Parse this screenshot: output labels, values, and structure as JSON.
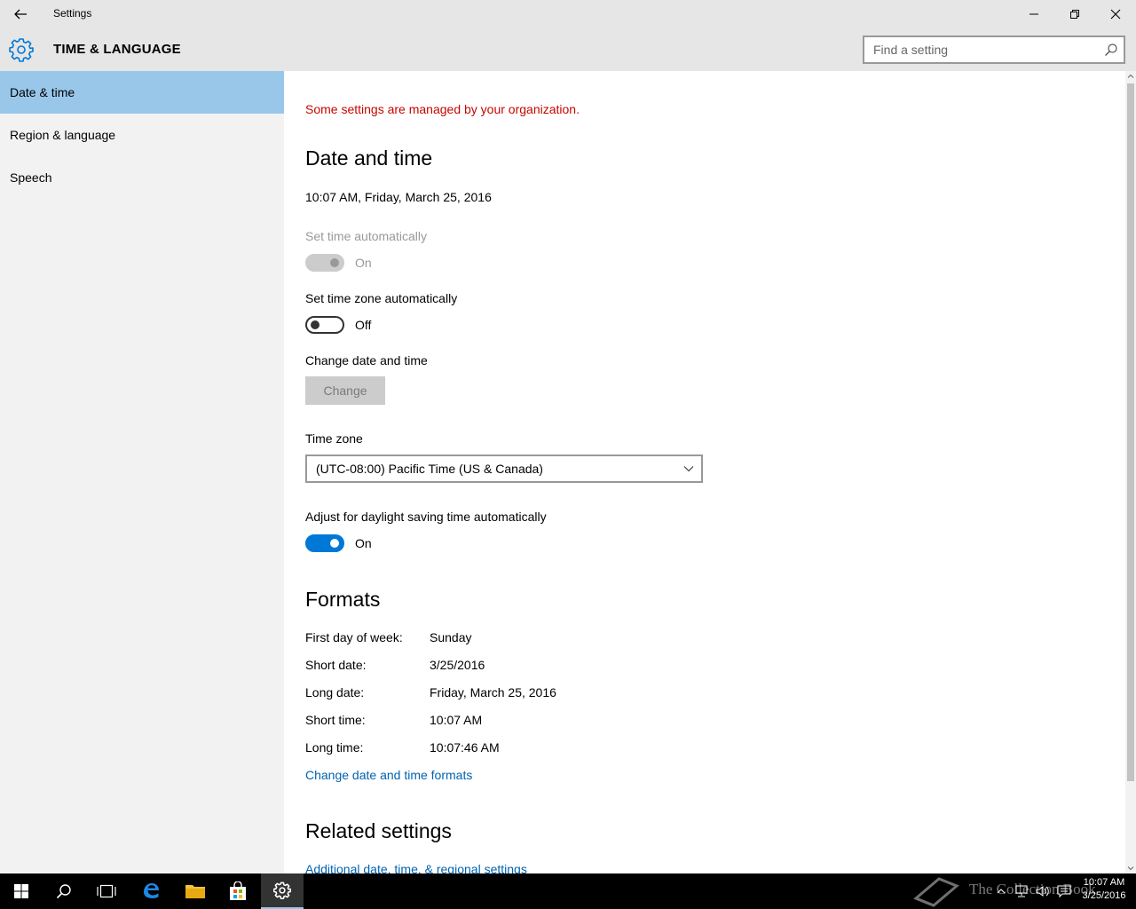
{
  "window": {
    "title": "Settings",
    "section_title": "TIME & LANGUAGE",
    "search_placeholder": "Find a setting"
  },
  "icons": {
    "back": "back-arrow-icon",
    "settings": "gear-icon",
    "search": "search-icon",
    "minimize": "minimize-icon",
    "maximize": "restore-icon",
    "close": "close-icon",
    "dropdown": "chevron-down-icon"
  },
  "colors": {
    "accent": "#0078d7",
    "nav_selected": "#99c7ea",
    "warning": "#c50500",
    "link": "#0063b1"
  },
  "sidebar": {
    "items": [
      {
        "label": "Date & time",
        "active": true
      },
      {
        "label": "Region & language",
        "active": false
      },
      {
        "label": "Speech",
        "active": false
      }
    ]
  },
  "main": {
    "managed_warning": "Some settings are managed by your organization.",
    "date_time_heading": "Date and time",
    "current_datetime": "10:07 AM, Friday, March 25, 2016",
    "set_time_auto": {
      "label": "Set time automatically",
      "state": "On"
    },
    "set_tz_auto": {
      "label": "Set time zone automatically",
      "state": "Off"
    },
    "change_dt": {
      "label": "Change date and time",
      "button": "Change"
    },
    "time_zone": {
      "label": "Time zone",
      "value": "(UTC-08:00) Pacific Time (US & Canada)"
    },
    "dst": {
      "label": "Adjust for daylight saving time automatically",
      "state": "On"
    },
    "formats_heading": "Formats",
    "formats": [
      {
        "label": "First day of week:",
        "value": "Sunday"
      },
      {
        "label": "Short date:",
        "value": "3/25/2016"
      },
      {
        "label": "Long date:",
        "value": "Friday, March 25, 2016"
      },
      {
        "label": "Short time:",
        "value": "10:07 AM"
      },
      {
        "label": "Long time:",
        "value": "10:07:46 AM"
      }
    ],
    "change_formats_link": "Change date and time formats",
    "related_heading": "Related settings",
    "related_link": "Additional date, time, & regional settings"
  },
  "taskbar": {
    "clock_time": "10:07 AM",
    "clock_date": "3/25/2016",
    "watermark": "The Collection Book"
  }
}
